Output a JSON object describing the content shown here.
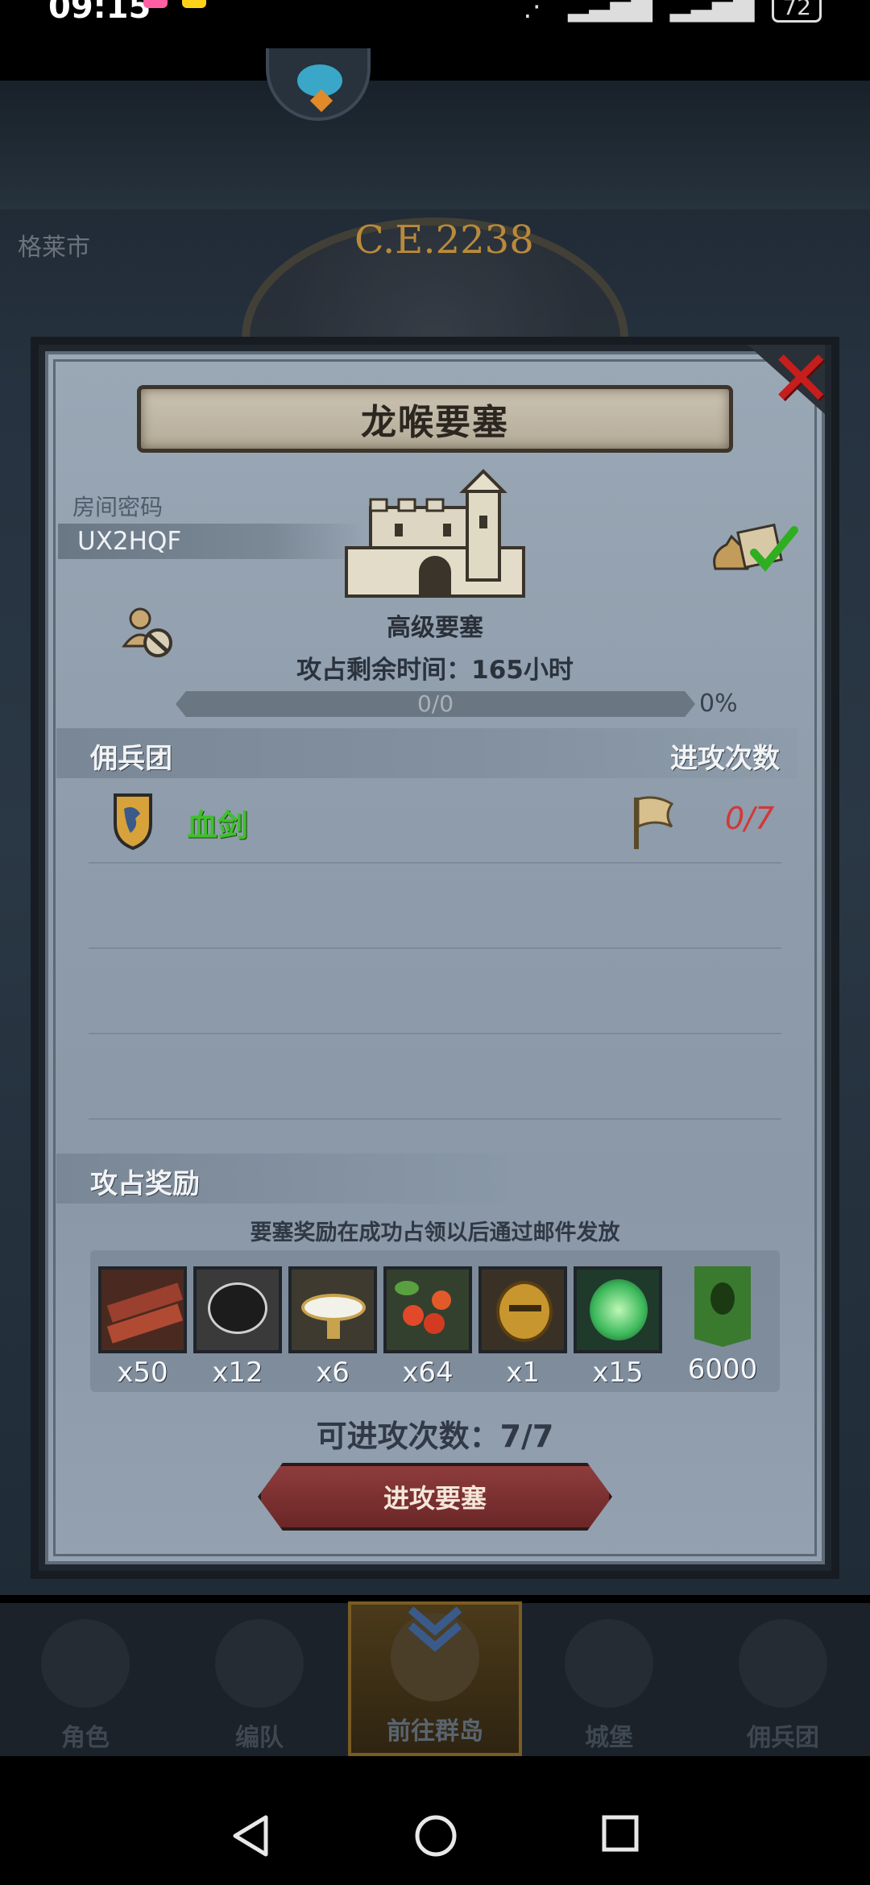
{
  "status_bar": {
    "time": "09:15",
    "battery": "72"
  },
  "background": {
    "era_label": "C.E.2238",
    "left_label": "格莱市"
  },
  "modal": {
    "title": "龙喉要塞",
    "room_code_label": "房间密码",
    "room_code": "UX2HQF",
    "fortress_type": "高级要塞",
    "time_remaining": "攻占剩余时间：165小时",
    "progress_text": "0/0",
    "progress_percent": "0%",
    "progress_value": 0,
    "mercenary_header": "佣兵团",
    "attack_count_header": "进攻次数",
    "mercenaries": [
      {
        "name": "血剑",
        "attacks": "0/7"
      }
    ],
    "reward_header": "攻占奖励",
    "reward_note": "要塞奖励在成功占领以后通过邮件发放",
    "rewards": [
      {
        "icon": "wood-planks-icon",
        "qty": "x50"
      },
      {
        "icon": "truffle-icon",
        "qty": "x12"
      },
      {
        "icon": "milk-bowl-icon",
        "qty": "x6"
      },
      {
        "icon": "berries-icon",
        "qty": "x64"
      },
      {
        "icon": "golden-helmet-icon",
        "qty": "x1"
      },
      {
        "icon": "green-tree-spirit-icon",
        "qty": "x15"
      },
      {
        "icon": "guild-banner-icon",
        "qty": "6000"
      }
    ],
    "attempts_left": "可进攻次数：7/7",
    "attack_button": "进攻要塞"
  },
  "bottom_nav": [
    {
      "label": "角色"
    },
    {
      "label": "编队"
    },
    {
      "label": "前往群岛"
    },
    {
      "label": "城堡"
    },
    {
      "label": "佣兵团"
    }
  ],
  "colors": {
    "accent_red": "#c61d1d",
    "merc_name_green": "#3fbf2c",
    "attack_count_red": "#d23838"
  }
}
